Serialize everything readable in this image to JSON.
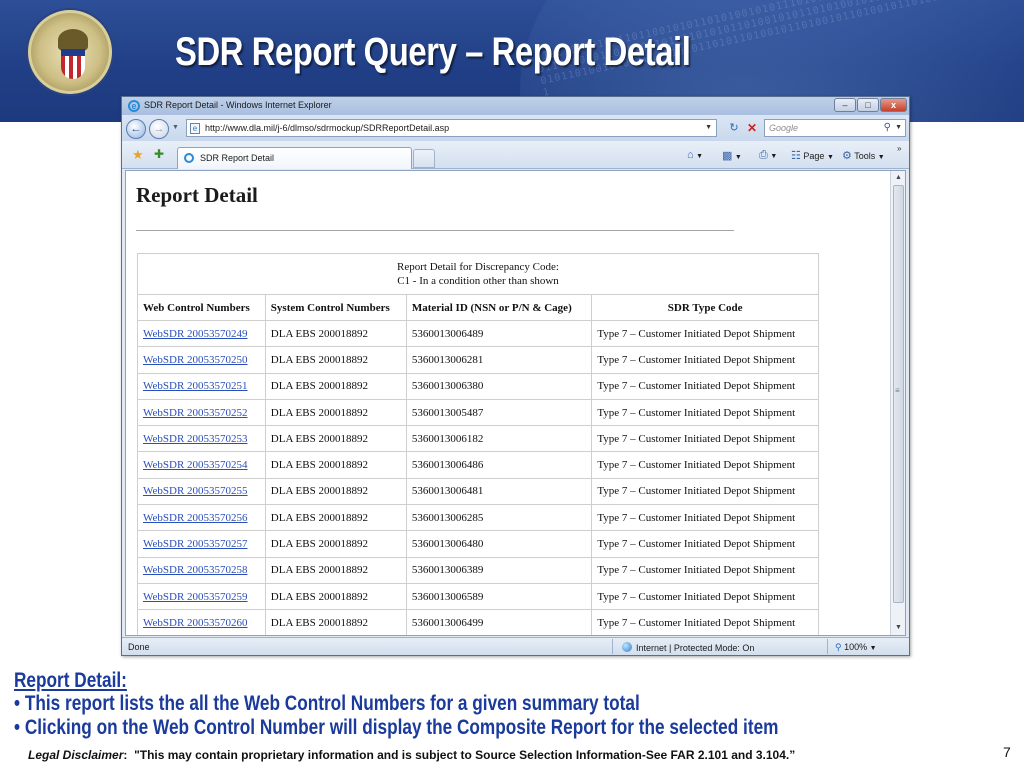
{
  "slide": {
    "title": "SDR Report Query – Report Detail",
    "notes_heading": "Report Detail:",
    "bullets": [
      "This report lists the all the Web Control Numbers for a given summary total",
      "Clicking on the Web Control Number will display the Composite Report for the selected item"
    ],
    "bullet_marker": "•",
    "disclaimer_label": "Legal Disclaimer",
    "disclaimer_sep": ":",
    "disclaimer_text": "\"This may contain proprietary information and is subject to Source Selection Information-See FAR 2.101 and 3.104.”",
    "page_number": "7"
  },
  "browser": {
    "window_title": "SDR Report Detail - Windows Internet Explorer",
    "window_buttons": {
      "minimize": "–",
      "maximize": "□",
      "close": "x"
    },
    "address": "http://www.dla.mil/j-6/dlmso/sdrmockup/SDRReportDetail.asp",
    "search_placeholder": "Google",
    "tab_label": "SDR Report Detail",
    "commands": {
      "page": "Page",
      "tools": "Tools"
    },
    "status": {
      "left": "Done",
      "zone": "Internet | Protected Mode: On",
      "zoom": "100%"
    },
    "icons": {
      "back": "back-arrow-icon",
      "forward": "forward-arrow-icon",
      "refresh": "refresh-icon",
      "stop": "stop-icon",
      "search": "magnifier-icon",
      "favorites": "star-icon",
      "add_favorite": "add-favorite-icon",
      "home": "home-icon",
      "feeds": "rss-feed-icon",
      "print": "printer-icon",
      "zone": "globe-icon"
    }
  },
  "page": {
    "heading": "Report Detail",
    "caption_line1": "Report Detail for Discrepancy Code:",
    "caption_line2": "C1 - In a condition other than shown",
    "columns": [
      "Web Control Numbers",
      "System Control Numbers",
      "Material ID (NSN or P/N & Cage)",
      "SDR Type Code"
    ],
    "rows": [
      [
        "WebSDR 20053570249",
        "DLA EBS 200018892",
        "5360013006489",
        "Type 7 – Customer Initiated Depot Shipment"
      ],
      [
        "WebSDR 20053570250",
        "DLA EBS 200018892",
        "5360013006281",
        "Type 7 – Customer Initiated Depot Shipment"
      ],
      [
        "WebSDR 20053570251",
        "DLA EBS 200018892",
        "5360013006380",
        "Type 7 – Customer Initiated Depot Shipment"
      ],
      [
        "WebSDR 20053570252",
        "DLA EBS 200018892",
        "5360013005487",
        "Type 7 – Customer Initiated Depot Shipment"
      ],
      [
        "WebSDR 20053570253",
        "DLA EBS 200018892",
        "5360013006182",
        "Type 7 – Customer Initiated Depot Shipment"
      ],
      [
        "WebSDR 20053570254",
        "DLA EBS 200018892",
        "5360013006486",
        "Type 7 – Customer Initiated Depot Shipment"
      ],
      [
        "WebSDR 20053570255",
        "DLA EBS 200018892",
        "5360013006481",
        "Type 7 – Customer Initiated Depot Shipment"
      ],
      [
        "WebSDR 20053570256",
        "DLA EBS 200018892",
        "5360013006285",
        "Type 7 – Customer Initiated Depot Shipment"
      ],
      [
        "WebSDR 20053570257",
        "DLA EBS 200018892",
        "5360013006480",
        "Type 7 – Customer Initiated Depot Shipment"
      ],
      [
        "WebSDR 20053570258",
        "DLA EBS 200018892",
        "5360013006389",
        "Type 7 – Customer Initiated Depot Shipment"
      ],
      [
        "WebSDR 20053570259",
        "DLA EBS 200018892",
        "5360013006589",
        "Type 7 – Customer Initiated Depot Shipment"
      ],
      [
        "WebSDR 20053570260",
        "DLA EBS 200018892",
        "5360013006499",
        "Type 7 – Customer Initiated Depot Shipment"
      ]
    ]
  },
  "colors": {
    "banner": "#213f86",
    "title_text": "#ffffff",
    "notes_text": "#1a3a9c",
    "link": "#2a4fb8"
  }
}
